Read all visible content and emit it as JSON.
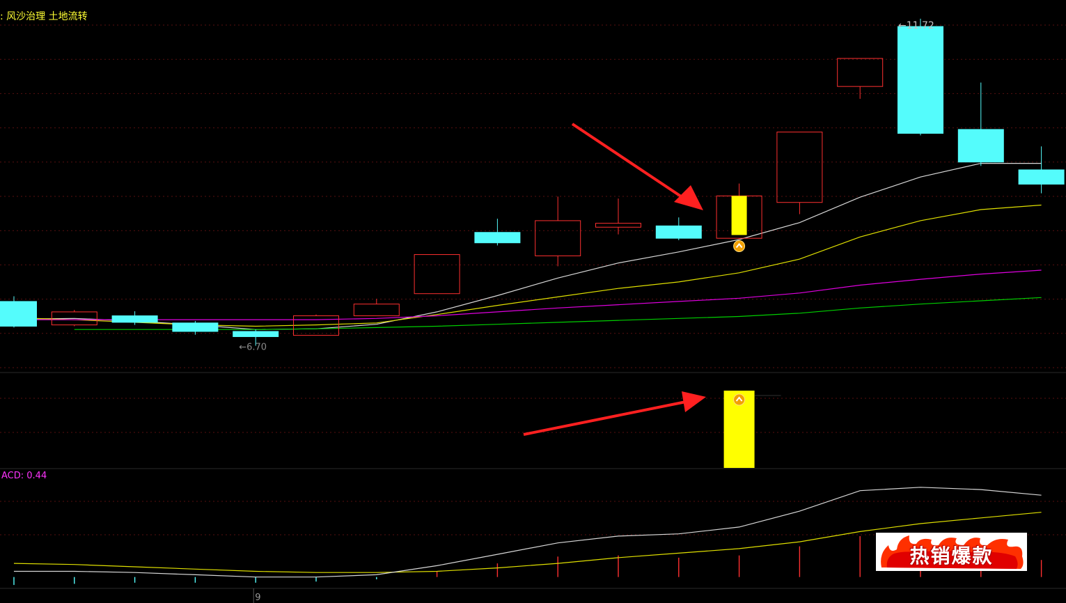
{
  "header": {
    "concepts": [
      ": 风沙治理",
      "土地流转"
    ]
  },
  "chart_data": {
    "type": "candlestick",
    "price_ylim": [
      6.3,
      11.9
    ],
    "candles": [
      {
        "open": 7.0,
        "close": 7.38,
        "high": 7.46,
        "low": 6.98,
        "color": "cyan"
      },
      {
        "open": 7.02,
        "close": 7.22,
        "high": 7.25,
        "low": 7.0,
        "color": "red"
      },
      {
        "open": 7.16,
        "close": 7.06,
        "high": 7.23,
        "low": 7.02,
        "color": "cyan"
      },
      {
        "open": 7.05,
        "close": 6.92,
        "high": 7.08,
        "low": 6.87,
        "color": "cyan"
      },
      {
        "open": 6.92,
        "close": 6.84,
        "high": 6.95,
        "low": 6.7,
        "color": "cyan"
      },
      {
        "open": 6.86,
        "close": 7.16,
        "high": 7.18,
        "low": 6.86,
        "color": "red"
      },
      {
        "open": 7.16,
        "close": 7.34,
        "high": 7.42,
        "low": 7.16,
        "color": "red"
      },
      {
        "open": 7.5,
        "close": 8.1,
        "high": 8.1,
        "low": 7.5,
        "color": "red"
      },
      {
        "open": 8.44,
        "close": 8.28,
        "high": 8.65,
        "low": 8.24,
        "color": "cyan"
      },
      {
        "open": 8.08,
        "close": 8.62,
        "high": 8.99,
        "low": 7.92,
        "color": "red"
      },
      {
        "open": 8.52,
        "close": 8.58,
        "high": 8.96,
        "low": 8.41,
        "color": "red"
      },
      {
        "open": 8.54,
        "close": 8.35,
        "high": 8.67,
        "low": 8.32,
        "color": "cyan"
      },
      {
        "open": 8.35,
        "close": 9.0,
        "high": 9.19,
        "low": 8.33,
        "color": "red"
      },
      {
        "open": 8.9,
        "close": 9.98,
        "high": 9.98,
        "low": 8.72,
        "color": "red"
      },
      {
        "open": 10.68,
        "close": 11.11,
        "high": 11.11,
        "low": 10.49,
        "color": "red"
      },
      {
        "open": 11.6,
        "close": 9.96,
        "high": 11.72,
        "low": 9.93,
        "color": "cyan"
      },
      {
        "open": 10.02,
        "close": 9.52,
        "high": 10.74,
        "low": 9.46,
        "color": "cyan"
      },
      {
        "open": 9.4,
        "close": 9.18,
        "high": 9.76,
        "low": 9.04,
        "color": "cyan"
      }
    ],
    "highlight_candle": {
      "index": 12,
      "open": 8.4,
      "close": 9.0,
      "color": "yellow"
    },
    "max_label": "11.72",
    "min_label": "6.70",
    "ma_lines": [
      {
        "color": "#d8d8d8",
        "values": [
          7.11,
          7.12,
          7.08,
          7.02,
          6.95,
          6.96,
          7.03,
          7.22,
          7.47,
          7.74,
          7.97,
          8.14,
          8.33,
          8.59,
          8.98,
          9.29,
          9.5,
          9.5
        ]
      },
      {
        "color": "#e0e000",
        "values": [
          7.13,
          7.1,
          7.06,
          7.02,
          7.0,
          7.02,
          7.05,
          7.18,
          7.32,
          7.45,
          7.58,
          7.68,
          7.82,
          8.03,
          8.37,
          8.62,
          8.79,
          8.86
        ]
      },
      {
        "color": "#e000e0",
        "values": [
          7.1,
          7.1,
          7.1,
          7.1,
          7.1,
          7.1,
          7.12,
          7.16,
          7.22,
          7.28,
          7.33,
          7.38,
          7.43,
          7.51,
          7.63,
          7.72,
          7.8,
          7.86
        ]
      },
      {
        "color": "#00d000",
        "values": [
          null,
          6.95,
          6.95,
          6.95,
          6.95,
          6.96,
          6.98,
          7.0,
          7.03,
          7.06,
          7.09,
          7.12,
          7.15,
          7.2,
          7.28,
          7.34,
          7.39,
          7.44
        ]
      }
    ],
    "signal_bar_index": 12,
    "macd": {
      "label": "ACD: 0.44",
      "dif": [
        0.05,
        0.05,
        0.04,
        0.02,
        0.0,
        0.0,
        0.02,
        0.1,
        0.2,
        0.3,
        0.36,
        0.38,
        0.44,
        0.58,
        0.76,
        0.79,
        0.77,
        0.72
      ],
      "dea": [
        0.12,
        0.11,
        0.09,
        0.07,
        0.05,
        0.04,
        0.04,
        0.05,
        0.08,
        0.12,
        0.17,
        0.21,
        0.25,
        0.31,
        0.4,
        0.47,
        0.52,
        0.57
      ],
      "hist": [
        -0.07,
        -0.06,
        -0.05,
        -0.05,
        -0.05,
        -0.04,
        -0.02,
        0.05,
        0.12,
        0.18,
        0.19,
        0.17,
        0.19,
        0.27,
        0.36,
        0.32,
        0.25,
        0.15
      ],
      "ylim": [
        -0.1,
        0.85
      ]
    },
    "x_tick_label": "9",
    "x_tick_index": 4
  },
  "badge": {
    "text": "热销爆款"
  },
  "colors": {
    "background": "#000000",
    "up": "#ff3030",
    "down": "#54fcfc",
    "signal": "#ffff00",
    "grid": "#5a1010",
    "axis_text": "#c0c0c0",
    "arrow": "#ff2020"
  }
}
